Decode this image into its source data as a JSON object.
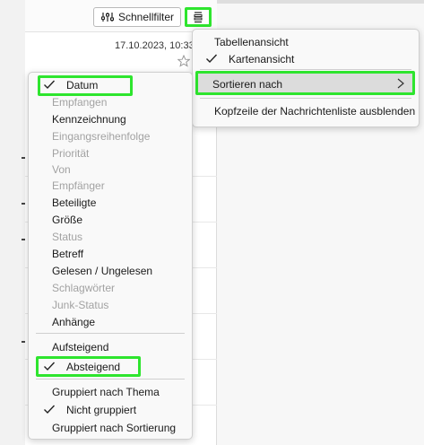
{
  "toolbar": {
    "quickfilter_label": "Schnellfilter"
  },
  "message_list": {
    "first_date": "17.10.2023, 10:33"
  },
  "view_menu": {
    "items": [
      {
        "label": "Tabellenansicht",
        "checked": false
      },
      {
        "label": "Kartenansicht",
        "checked": true
      }
    ],
    "sort_label": "Sortieren nach",
    "hide_header_label": "Kopfzeile der Nachrichtenliste ausblenden"
  },
  "sort_menu": {
    "sort_fields": [
      {
        "label": "Datum",
        "checked": true,
        "disabled": false
      },
      {
        "label": "Empfangen",
        "checked": false,
        "disabled": true
      },
      {
        "label": "Kennzeichnung",
        "checked": false,
        "disabled": false
      },
      {
        "label": "Eingangsreihenfolge",
        "checked": false,
        "disabled": true
      },
      {
        "label": "Priorität",
        "checked": false,
        "disabled": true
      },
      {
        "label": "Von",
        "checked": false,
        "disabled": true
      },
      {
        "label": "Empfänger",
        "checked": false,
        "disabled": true
      },
      {
        "label": "Beteiligte",
        "checked": false,
        "disabled": false
      },
      {
        "label": "Größe",
        "checked": false,
        "disabled": false
      },
      {
        "label": "Status",
        "checked": false,
        "disabled": true
      },
      {
        "label": "Betreff",
        "checked": false,
        "disabled": false
      },
      {
        "label": "Gelesen / Ungelesen",
        "checked": false,
        "disabled": false
      },
      {
        "label": "Schlagwörter",
        "checked": false,
        "disabled": true
      },
      {
        "label": "Junk-Status",
        "checked": false,
        "disabled": true
      },
      {
        "label": "Anhänge",
        "checked": false,
        "disabled": false
      }
    ],
    "direction": [
      {
        "label": "Aufsteigend",
        "checked": false
      },
      {
        "label": "Absteigend",
        "checked": true
      }
    ],
    "grouping": [
      {
        "label": "Gruppiert nach Thema",
        "checked": false
      },
      {
        "label": "Nicht gruppiert",
        "checked": true
      },
      {
        "label": "Gruppiert nach Sortierung",
        "checked": false
      }
    ]
  },
  "colors": {
    "highlight": "#2ee52e",
    "menu_bg": "#f9f9f9",
    "disabled_text": "#a2a2a2"
  },
  "icons": {
    "quickfilter": "sliders-icon",
    "view_options": "list-view-icon",
    "check": "checkmark-icon",
    "submenu": "chevron-right-icon",
    "star": "star-icon"
  }
}
